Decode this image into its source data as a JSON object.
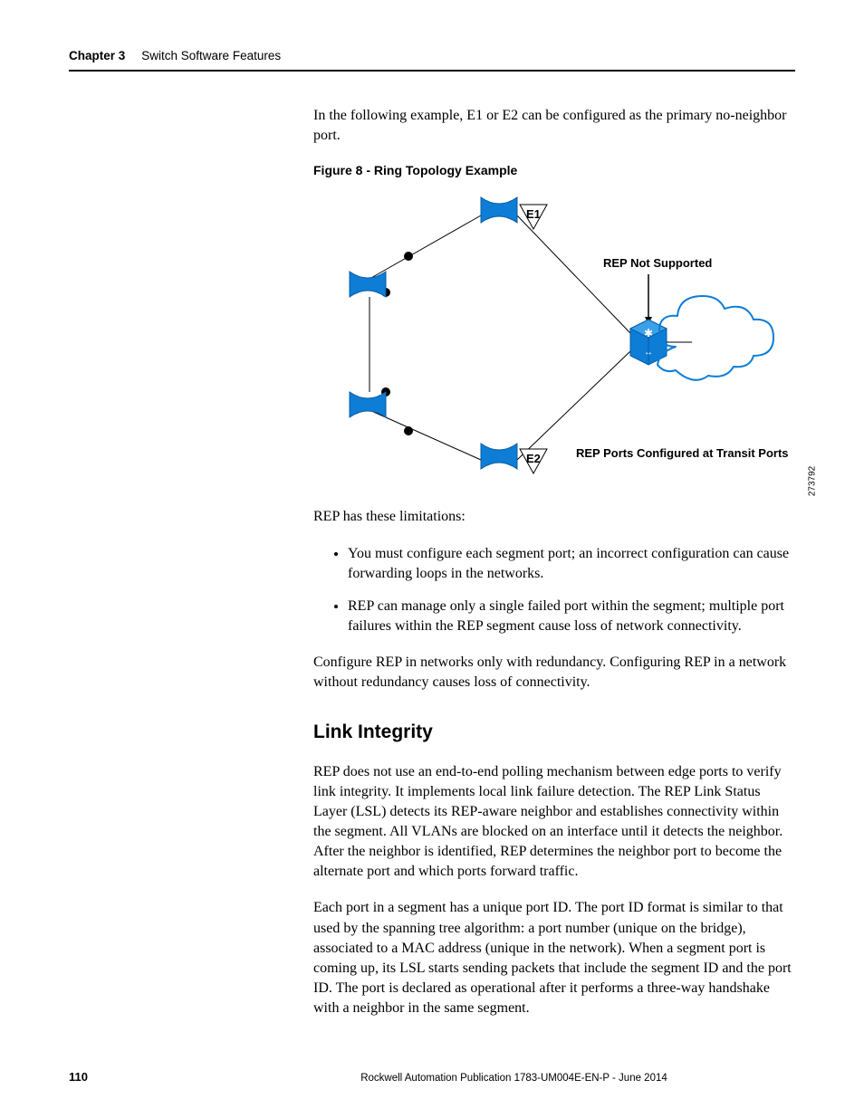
{
  "header": {
    "chapter_label": "Chapter 3",
    "chapter_title": "Switch Software Features"
  },
  "intro_para": "In the following example, E1 or E2 can be configured as the primary no-neighbor port.",
  "figure": {
    "caption": "Figure 8 - Ring Topology Example",
    "label_e1": "E1",
    "label_e2": "E2",
    "label_not_supported": "REP Not Supported",
    "label_transit": "REP Ports Configured at Transit Ports",
    "side_number": "273792"
  },
  "limitations_intro": "REP has these limitations:",
  "limitations": [
    "You must configure each segment port; an incorrect configuration can cause forwarding loops in the networks.",
    "REP can manage only a single failed port within the segment; multiple port failures within the REP segment cause loss of network connectivity."
  ],
  "config_note": "Configure REP in networks only with redundancy. Configuring REP in a network without redundancy causes loss of connectivity.",
  "section_heading": "Link Integrity",
  "para1": "REP does not use an end-to-end polling mechanism between edge ports to verify link integrity. It implements local link failure detection. The REP Link Status Layer (LSL) detects its REP-aware neighbor and establishes connectivity within the segment. All VLANs are blocked on an interface until it detects the neighbor. After the neighbor is identified, REP determines the neighbor port to become the alternate port and which ports forward traffic.",
  "para2": "Each port in a segment has a unique port ID. The port ID format is similar to that used by the spanning tree algorithm: a port number (unique on the bridge), associated to a MAC address (unique in the network). When a segment port is coming up, its LSL starts sending packets that include the segment ID and the port ID. The port is declared as operational after it performs a three-way handshake with a neighbor in the same segment.",
  "footer": {
    "page": "110",
    "publication": "Rockwell Automation Publication 1783-UM004E-EN-P - June 2014"
  }
}
